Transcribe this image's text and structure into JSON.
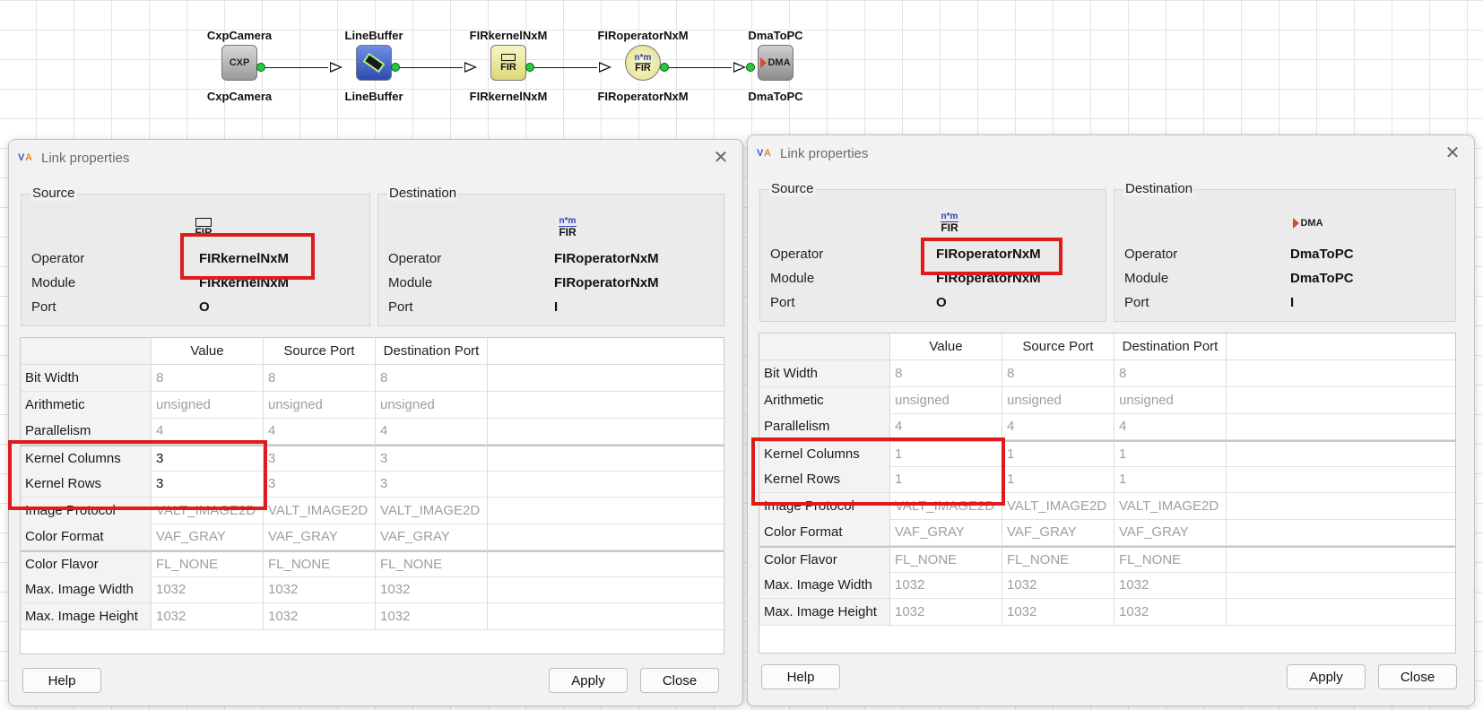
{
  "pipeline": {
    "nodes": [
      {
        "top": "CxpCamera",
        "bottom": "CxpCamera",
        "icon": "cxp-camera-icon",
        "glyph": "CXP"
      },
      {
        "top": "LineBuffer",
        "bottom": "LineBuffer",
        "icon": "linebuffer-icon",
        "glyph": ""
      },
      {
        "top": "FIRkernelNxM",
        "bottom": "FIRkernelNxM",
        "icon": "fir-kernel-icon",
        "glyph": "FIR"
      },
      {
        "top": "FIRoperatorNxM",
        "bottom": "FIRoperatorNxM",
        "icon": "fir-operator-icon",
        "glyph": "FIR",
        "glyph_top": "n*m"
      },
      {
        "top": "DmaToPC",
        "bottom": "DmaToPC",
        "icon": "dma-icon",
        "glyph": "DMA"
      }
    ]
  },
  "dialogs": [
    {
      "title": "Link properties",
      "source": {
        "group_title": "Source",
        "icon_glyph": "FIR",
        "operator_label": "Operator",
        "operator": "FIRkernelNxM",
        "module_label": "Module",
        "module": "FIRkernelNxM",
        "port_label": "Port",
        "port": "O"
      },
      "destination": {
        "group_title": "Destination",
        "icon_glyph": "FIR",
        "icon_glyph_top": "n*m",
        "operator_label": "Operator",
        "operator": "FIRoperatorNxM",
        "module_label": "Module",
        "module": "FIRoperatorNxM",
        "port_label": "Port",
        "port": "I"
      },
      "table": {
        "headers": [
          "Value",
          "Source Port",
          "Destination Port"
        ],
        "rows": [
          {
            "name": "Bit Width",
            "value": "8",
            "src": "8",
            "dst": "8"
          },
          {
            "name": "Arithmetic",
            "value": "unsigned",
            "src": "unsigned",
            "dst": "unsigned"
          },
          {
            "name": "Parallelism",
            "value": "4",
            "src": "4",
            "dst": "4"
          },
          {
            "name": "Kernel Columns",
            "value": "3",
            "src": "3",
            "dst": "3",
            "editable": true
          },
          {
            "name": "Kernel Rows",
            "value": "3",
            "src": "3",
            "dst": "3",
            "editable": true
          },
          {
            "name": "Image Protocol",
            "value": "VALT_IMAGE2D",
            "src": "VALT_IMAGE2D",
            "dst": "VALT_IMAGE2D"
          },
          {
            "name": "Color Format",
            "value": "VAF_GRAY",
            "src": "VAF_GRAY",
            "dst": "VAF_GRAY"
          },
          {
            "name": "Color Flavor",
            "value": "FL_NONE",
            "src": "FL_NONE",
            "dst": "FL_NONE"
          },
          {
            "name": "Max. Image Width",
            "value": "1032",
            "src": "1032",
            "dst": "1032"
          },
          {
            "name": "Max. Image Height",
            "value": "1032",
            "src": "1032",
            "dst": "1032"
          }
        ]
      },
      "buttons": {
        "help": "Help",
        "apply": "Apply",
        "close": "Close"
      }
    },
    {
      "title": "Link properties",
      "source": {
        "group_title": "Source",
        "icon_glyph": "FIR",
        "icon_glyph_top": "n*m",
        "operator_label": "Operator",
        "operator": "FIRoperatorNxM",
        "module_label": "Module",
        "module": "FIRoperatorNxM",
        "port_label": "Port",
        "port": "O"
      },
      "destination": {
        "group_title": "Destination",
        "icon_glyph": "DMA",
        "operator_label": "Operator",
        "operator": "DmaToPC",
        "module_label": "Module",
        "module": "DmaToPC",
        "port_label": "Port",
        "port": "I"
      },
      "table": {
        "headers": [
          "Value",
          "Source Port",
          "Destination Port"
        ],
        "rows": [
          {
            "name": "Bit Width",
            "value": "8",
            "src": "8",
            "dst": "8"
          },
          {
            "name": "Arithmetic",
            "value": "unsigned",
            "src": "unsigned",
            "dst": "unsigned"
          },
          {
            "name": "Parallelism",
            "value": "4",
            "src": "4",
            "dst": "4"
          },
          {
            "name": "Kernel Columns",
            "value": "1",
            "src": "1",
            "dst": "1"
          },
          {
            "name": "Kernel Rows",
            "value": "1",
            "src": "1",
            "dst": "1"
          },
          {
            "name": "Image Protocol",
            "value": "VALT_IMAGE2D",
            "src": "VALT_IMAGE2D",
            "dst": "VALT_IMAGE2D"
          },
          {
            "name": "Color Format",
            "value": "VAF_GRAY",
            "src": "VAF_GRAY",
            "dst": "VAF_GRAY"
          },
          {
            "name": "Color Flavor",
            "value": "FL_NONE",
            "src": "FL_NONE",
            "dst": "FL_NONE"
          },
          {
            "name": "Max. Image Width",
            "value": "1032",
            "src": "1032",
            "dst": "1032"
          },
          {
            "name": "Max. Image Height",
            "value": "1032",
            "src": "1032",
            "dst": "1032"
          }
        ]
      },
      "buttons": {
        "help": "Help",
        "apply": "Apply",
        "close": "Close"
      }
    }
  ],
  "colors": {
    "highlight": "#e01b1b",
    "port_green": "#27c93f",
    "grid": "#e4e4e4"
  }
}
